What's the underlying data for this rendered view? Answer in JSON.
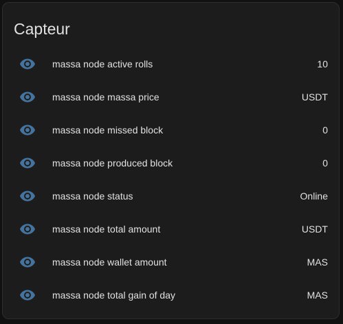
{
  "card": {
    "title": "Capteur"
  },
  "colors": {
    "icon": "#44739e",
    "background": "#111111",
    "card": "#1c1c1c",
    "text": "#e1e1e1"
  },
  "rows": [
    {
      "icon": "eye-icon",
      "name": "massa node active rolls",
      "state": "10"
    },
    {
      "icon": "eye-icon",
      "name": "massa node massa price",
      "state": "USDT"
    },
    {
      "icon": "eye-icon",
      "name": "massa node missed block",
      "state": "0"
    },
    {
      "icon": "eye-icon",
      "name": "massa node produced block",
      "state": "0"
    },
    {
      "icon": "eye-icon",
      "name": "massa node status",
      "state": "Online"
    },
    {
      "icon": "eye-icon",
      "name": "massa node total amount",
      "state": "USDT"
    },
    {
      "icon": "eye-icon",
      "name": "massa node wallet amount",
      "state": "MAS"
    },
    {
      "icon": "eye-icon",
      "name": "massa node total gain of day",
      "state": "MAS"
    }
  ]
}
